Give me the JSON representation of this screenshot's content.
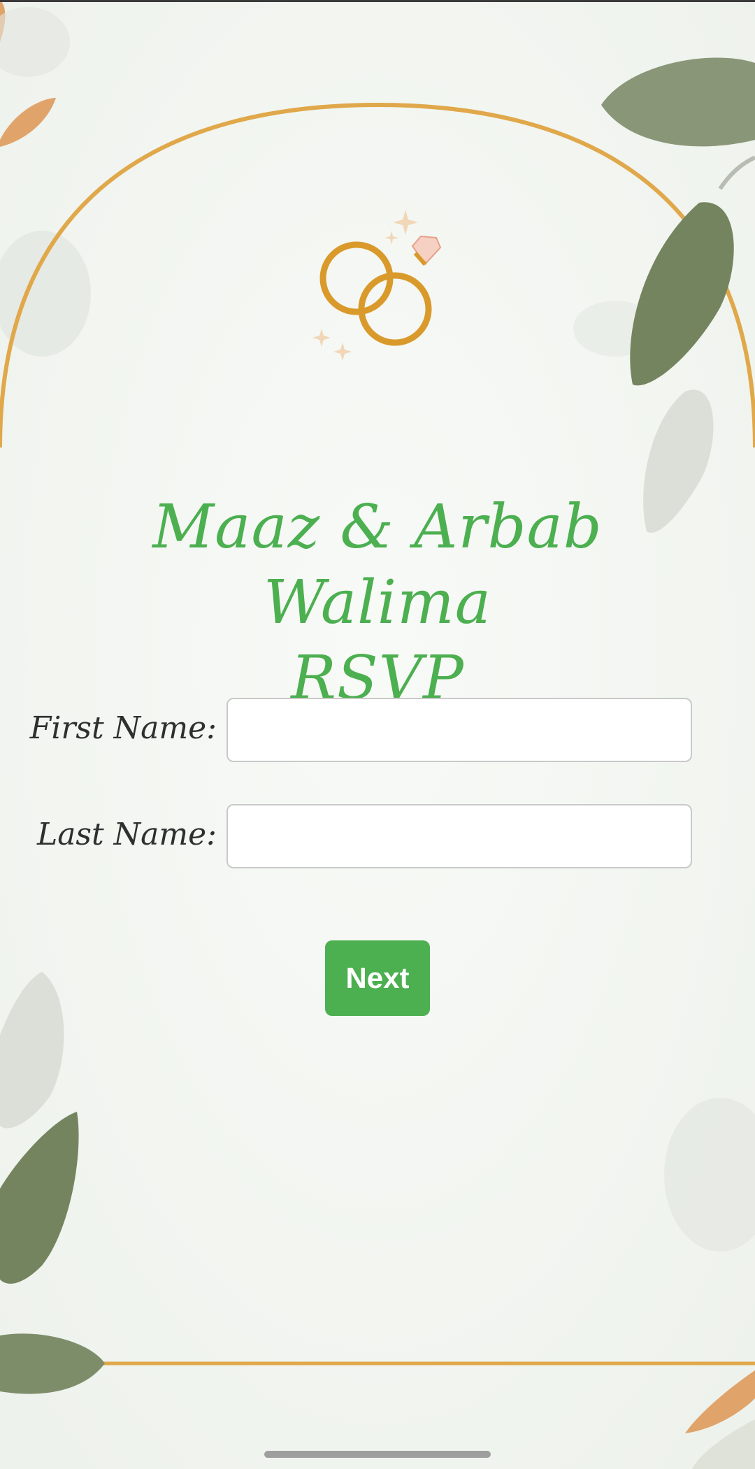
{
  "header": {
    "title_line1": "Maaz & Arbab Walima",
    "title_line2": "RSVP"
  },
  "form": {
    "first_name_label": "First Name:",
    "first_name_value": "",
    "last_name_label": "Last Name:",
    "last_name_value": "",
    "next_label": "Next"
  },
  "colors": {
    "title": "#4caf50",
    "button": "#4caf50",
    "arch": "#e0a84a",
    "rings": "#d99a2b",
    "leaf": "#7f8f6c"
  },
  "icons": {
    "rings": "wedding-rings-icon"
  }
}
